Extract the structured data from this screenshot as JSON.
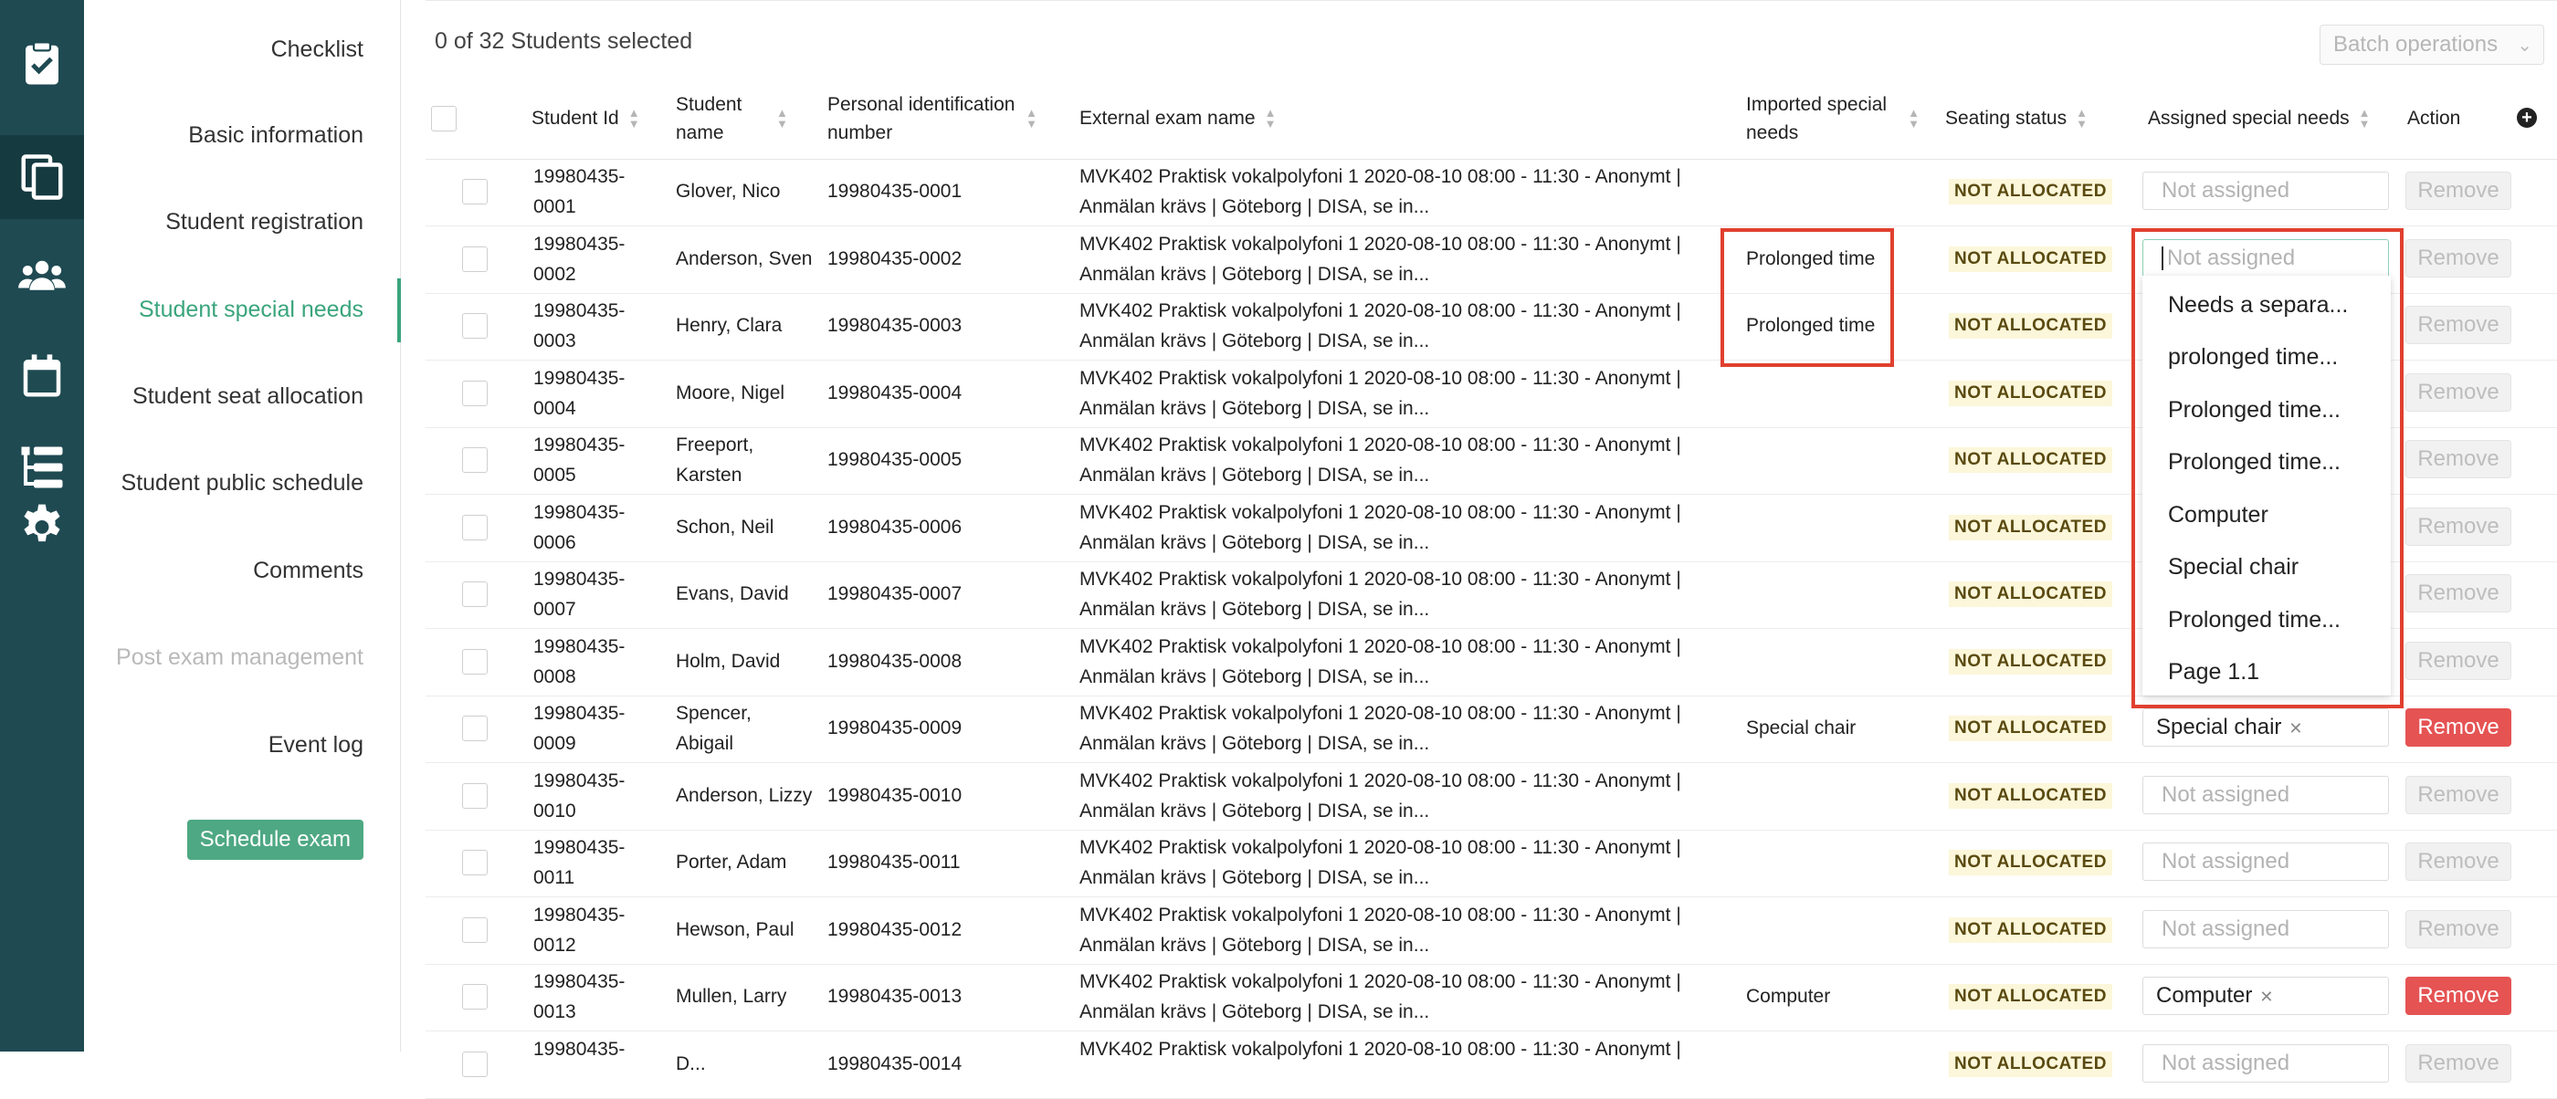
{
  "sidebar_rail": {
    "icons": [
      "clipboard-check-icon",
      "copy-pages-icon",
      "people-icon",
      "calendar-icon",
      "list-tree-icon",
      "gear-icon"
    ]
  },
  "nav": {
    "items": [
      {
        "label": "Checklist"
      },
      {
        "label": "Basic information"
      },
      {
        "label": "Student registration"
      },
      {
        "label": "Student special needs"
      },
      {
        "label": "Student seat allocation"
      },
      {
        "label": "Student public schedule"
      },
      {
        "label": "Comments"
      },
      {
        "label": "Post exam management"
      },
      {
        "label": "Event log"
      }
    ],
    "schedule_button": "Schedule exam"
  },
  "toolbar": {
    "selected_text": "0 of 32 Students selected",
    "batch_placeholder": "Batch operations"
  },
  "table": {
    "headers": {
      "student_id": "Student Id",
      "student_name": "Student name",
      "pin": "Personal identification number",
      "exam": "External exam name",
      "imported": "Imported special needs",
      "seating": "Seating status",
      "assigned": "Assigned special needs",
      "action": "Action"
    },
    "rows": [
      {
        "id1": "19980435-",
        "id2": "0001",
        "name1": "Glover, Nico",
        "name2": "",
        "pin": "19980435-0001",
        "exam1": "MVK402 Praktisk vokalpolyfoni 1 2020-08-10 08:00 - 11:30 - Anonymt |",
        "exam2": "Anmälan krävs | Göteborg | DISA, se in...",
        "imported": "",
        "status": "NOT ALLOCATED",
        "assigned": "Not assigned",
        "remove": "Remove"
      },
      {
        "id1": "19980435-",
        "id2": "0002",
        "name1": "Anderson, Sven",
        "name2": "",
        "pin": "19980435-0002",
        "exam1": "MVK402 Praktisk vokalpolyfoni 1 2020-08-10 08:00 - 11:30 - Anonymt |",
        "exam2": "Anmälan krävs | Göteborg | DISA, se in...",
        "imported": "Prolonged time",
        "status": "NOT ALLOCATED",
        "assigned": "Not assigned",
        "remove": "Remove"
      },
      {
        "id1": "19980435-",
        "id2": "0003",
        "name1": "Henry, Clara",
        "name2": "",
        "pin": "19980435-0003",
        "exam1": "MVK402 Praktisk vokalpolyfoni 1 2020-08-10 08:00 - 11:30 - Anonymt |",
        "exam2": "Anmälan krävs | Göteborg | DISA, se in...",
        "imported": "Prolonged time",
        "status": "NOT ALLOCATED",
        "assigned": "",
        "remove": "Remove"
      },
      {
        "id1": "19980435-",
        "id2": "0004",
        "name1": "Moore, Nigel",
        "name2": "",
        "pin": "19980435-0004",
        "exam1": "MVK402 Praktisk vokalpolyfoni 1 2020-08-10 08:00 - 11:30 - Anonymt |",
        "exam2": "Anmälan krävs | Göteborg | DISA, se in...",
        "imported": "",
        "status": "NOT ALLOCATED",
        "assigned": "",
        "remove": "Remove"
      },
      {
        "id1": "19980435-",
        "id2": "0005",
        "name1": "Freeport,",
        "name2": "Karsten",
        "pin": "19980435-0005",
        "exam1": "MVK402 Praktisk vokalpolyfoni 1 2020-08-10 08:00 - 11:30 - Anonymt |",
        "exam2": "Anmälan krävs | Göteborg | DISA, se in...",
        "imported": "",
        "status": "NOT ALLOCATED",
        "assigned": "",
        "remove": "Remove"
      },
      {
        "id1": "19980435-",
        "id2": "0006",
        "name1": "Schon, Neil",
        "name2": "",
        "pin": "19980435-0006",
        "exam1": "MVK402 Praktisk vokalpolyfoni 1 2020-08-10 08:00 - 11:30 - Anonymt |",
        "exam2": "Anmälan krävs | Göteborg | DISA, se in...",
        "imported": "",
        "status": "NOT ALLOCATED",
        "assigned": "",
        "remove": "Remove"
      },
      {
        "id1": "19980435-",
        "id2": "0007",
        "name1": "Evans, David",
        "name2": "",
        "pin": "19980435-0007",
        "exam1": "MVK402 Praktisk vokalpolyfoni 1 2020-08-10 08:00 - 11:30 - Anonymt |",
        "exam2": "Anmälan krävs | Göteborg | DISA, se in...",
        "imported": "",
        "status": "NOT ALLOCATED",
        "assigned": "",
        "remove": "Remove"
      },
      {
        "id1": "19980435-",
        "id2": "0008",
        "name1": "Holm, David",
        "name2": "",
        "pin": "19980435-0008",
        "exam1": "MVK402 Praktisk vokalpolyfoni 1 2020-08-10 08:00 - 11:30 - Anonymt |",
        "exam2": "Anmälan krävs | Göteborg | DISA, se in...",
        "imported": "",
        "status": "NOT ALLOCATED",
        "assigned": "",
        "remove": "Remove"
      },
      {
        "id1": "19980435-",
        "id2": "0009",
        "name1": "Spencer,",
        "name2": "Abigail",
        "pin": "19980435-0009",
        "exam1": "MVK402 Praktisk vokalpolyfoni 1 2020-08-10 08:00 - 11:30 - Anonymt |",
        "exam2": "Anmälan krävs | Göteborg | DISA, se in...",
        "imported": "Special chair",
        "status": "NOT ALLOCATED",
        "assigned": "Special chair",
        "remove": "Remove"
      },
      {
        "id1": "19980435-",
        "id2": "0010",
        "name1": "Anderson, Lizzy",
        "name2": "",
        "pin": "19980435-0010",
        "exam1": "MVK402 Praktisk vokalpolyfoni 1 2020-08-10 08:00 - 11:30 - Anonymt |",
        "exam2": "Anmälan krävs | Göteborg | DISA, se in...",
        "imported": "",
        "status": "NOT ALLOCATED",
        "assigned": "Not assigned",
        "remove": "Remove"
      },
      {
        "id1": "19980435-",
        "id2": "0011",
        "name1": "Porter, Adam",
        "name2": "",
        "pin": "19980435-0011",
        "exam1": "MVK402 Praktisk vokalpolyfoni 1 2020-08-10 08:00 - 11:30 - Anonymt |",
        "exam2": "Anmälan krävs | Göteborg | DISA, se in...",
        "imported": "",
        "status": "NOT ALLOCATED",
        "assigned": "Not assigned",
        "remove": "Remove"
      },
      {
        "id1": "19980435-",
        "id2": "0012",
        "name1": "Hewson, Paul",
        "name2": "",
        "pin": "19980435-0012",
        "exam1": "MVK402 Praktisk vokalpolyfoni 1 2020-08-10 08:00 - 11:30 - Anonymt |",
        "exam2": "Anmälan krävs | Göteborg | DISA, se in...",
        "imported": "",
        "status": "NOT ALLOCATED",
        "assigned": "Not assigned",
        "remove": "Remove"
      },
      {
        "id1": "19980435-",
        "id2": "0013",
        "name1": "Mullen, Larry",
        "name2": "",
        "pin": "19980435-0013",
        "exam1": "MVK402 Praktisk vokalpolyfoni 1 2020-08-10 08:00 - 11:30 - Anonymt |",
        "exam2": "Anmälan krävs | Göteborg | DISA, se in...",
        "imported": "Computer",
        "status": "NOT ALLOCATED",
        "assigned": "Computer",
        "remove": "Remove"
      },
      {
        "id1": "19980435-",
        "id2": "",
        "name1": "D...",
        "name2": "",
        "pin": "19980435-0014",
        "exam1": "MVK402 Praktisk vokalpolyfoni 1 2020-08-10 08:00 - 11:30 - Anonymt |",
        "exam2": "",
        "imported": "",
        "status": "NOT ALLOCATED",
        "assigned": "Not assigned",
        "remove": "Remove"
      }
    ]
  },
  "dropdown": {
    "options": [
      "Needs a separa...",
      "prolonged time...",
      "Prolonged time...",
      "Prolonged time...",
      "Computer",
      "Special chair",
      "Prolonged time...",
      "Page 1.1"
    ]
  },
  "colors": {
    "rail": "#1f4a52",
    "accent": "#3aa57c",
    "badge_bg": "#fcf7da",
    "remove_active": "#e55353",
    "highlight_box": "#e0402f"
  }
}
